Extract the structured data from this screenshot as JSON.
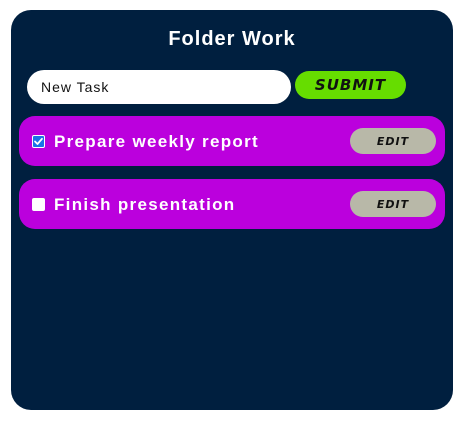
{
  "header": {
    "title": "Folder Work"
  },
  "form": {
    "input_value": "New Task",
    "submit_label": "SUBMIT"
  },
  "tasks": [
    {
      "label": "Prepare weekly report",
      "checked": true,
      "edit_label": "EDIT"
    },
    {
      "label": "Finish presentation",
      "checked": false,
      "edit_label": "EDIT"
    }
  ],
  "colors": {
    "background": "#001f3f",
    "task_item": "#bb00dd",
    "submit_button": "#66dd00",
    "edit_button": "#b8b8a8",
    "checkbox_checked": "#1a73e8"
  }
}
